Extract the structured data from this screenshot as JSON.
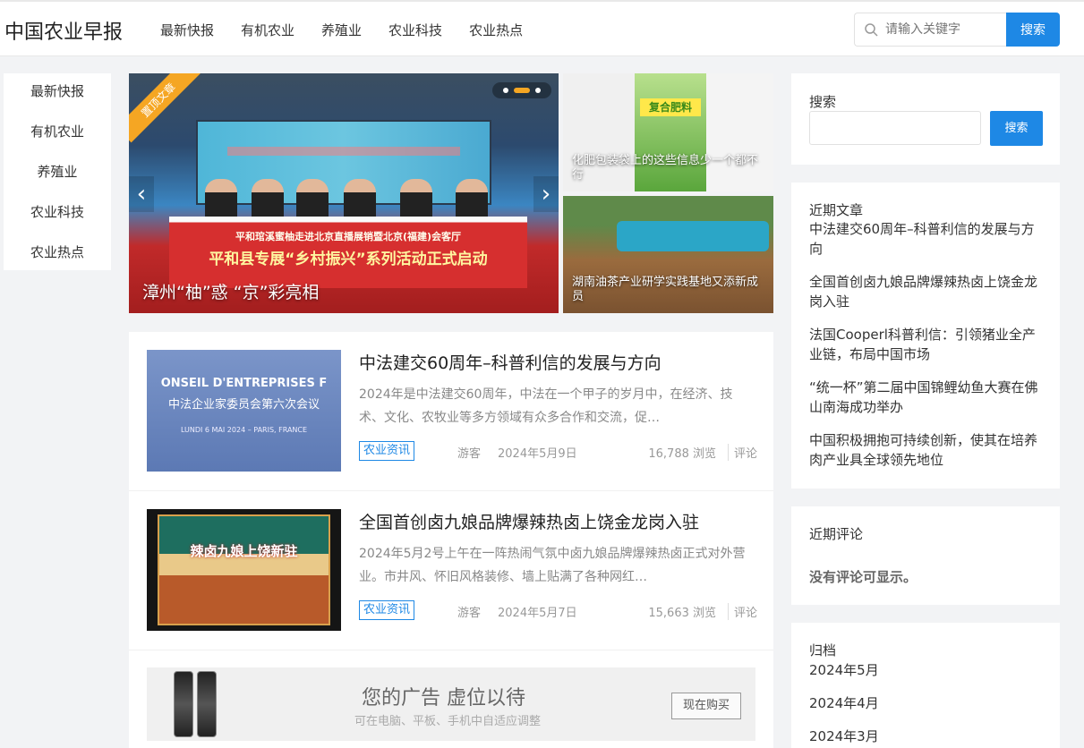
{
  "site": {
    "title": "中国农业早报"
  },
  "nav": [
    "最新快报",
    "有机农业",
    "养殖业",
    "农业科技",
    "农业热点"
  ],
  "header_search": {
    "placeholder": "请输入关键字",
    "button": "搜索"
  },
  "left_nav": [
    "最新快报",
    "有机农业",
    "养殖业",
    "农业科技",
    "农业热点"
  ],
  "slider": {
    "corner_label": "置顶文章",
    "caption": "漳州“柚”惑 “京”彩亮相",
    "screen_banner_line1": "平和琯溪蜜柚走进北京直播展销暨北京(福建)会客厅",
    "screen_banner_line2": "平和县专展“乡村振兴”系列活动正式启动",
    "prev": "‹",
    "next": "›"
  },
  "tiles": [
    {
      "caption": "化肥包装袋上的这些信息少一个都不行",
      "bag_label": "复合肥料"
    },
    {
      "caption": "湖南油茶产业研学实践基地又添新成员"
    }
  ],
  "articles": [
    {
      "title": "中法建交60周年–科普利信的发展与方向",
      "desc": "2024年是中法建交60周年，中法在一个甲子的岁月中，在经济、技术、文化、农牧业等多方领域有众多合作和交流，促…",
      "tag": "农业资讯",
      "author": "游客",
      "date": "2024年5月9日",
      "views": "16,788 浏览",
      "comments": "评论",
      "thumb_lines": [
        "ONSEIL D'ENTREPRISES F",
        "中法企业家委员会第六次会议",
        "LUNDI 6 MAI 2024 – PARIS, FRANCE"
      ]
    },
    {
      "title": "全国首创卤九娘品牌爆辣热卤上饶金龙岗入驻",
      "desc": "2024年5月2号上午在一阵热闹气氛中卤九娘品牌爆辣热卤正式对外营业。市井风、怀旧风格装修、墙上贴满了各种网红…",
      "tag": "农业资讯",
      "author": "游客",
      "date": "2024年5月7日",
      "views": "15,663 浏览",
      "comments": "评论",
      "thumb_lines": [
        "辣卤九娘上饶新驻"
      ]
    }
  ],
  "ad": {
    "title": "您的广告 虚位以待",
    "subtitle": "可在电脑、平板、手机中自适应调整",
    "button": "现在购买"
  },
  "sidebar": {
    "search": {
      "title": "搜索",
      "button": "搜索"
    },
    "recent": {
      "title": "近期文章",
      "items": [
        "中法建交60周年–科普利信的发展与方向",
        "全国首创卤九娘品牌爆辣热卤上饶金龙岗入驻",
        "法国Cooperl科普利信：引领猪业全产业链，布局中国市场",
        "“统一杯”第二届中国锦鲤幼鱼大赛在佛山南海成功举办",
        "中国积极拥抱可持续创新，使其在培养肉产业具全球领先地位"
      ]
    },
    "comments": {
      "title": "近期评论",
      "empty": "没有评论可显示。"
    },
    "archive": {
      "title": "归档",
      "items": [
        "2024年5月",
        "2024年4月",
        "2024年3月"
      ]
    }
  },
  "colors": {
    "accent": "#1e88e5",
    "corner": "#f5a623"
  }
}
